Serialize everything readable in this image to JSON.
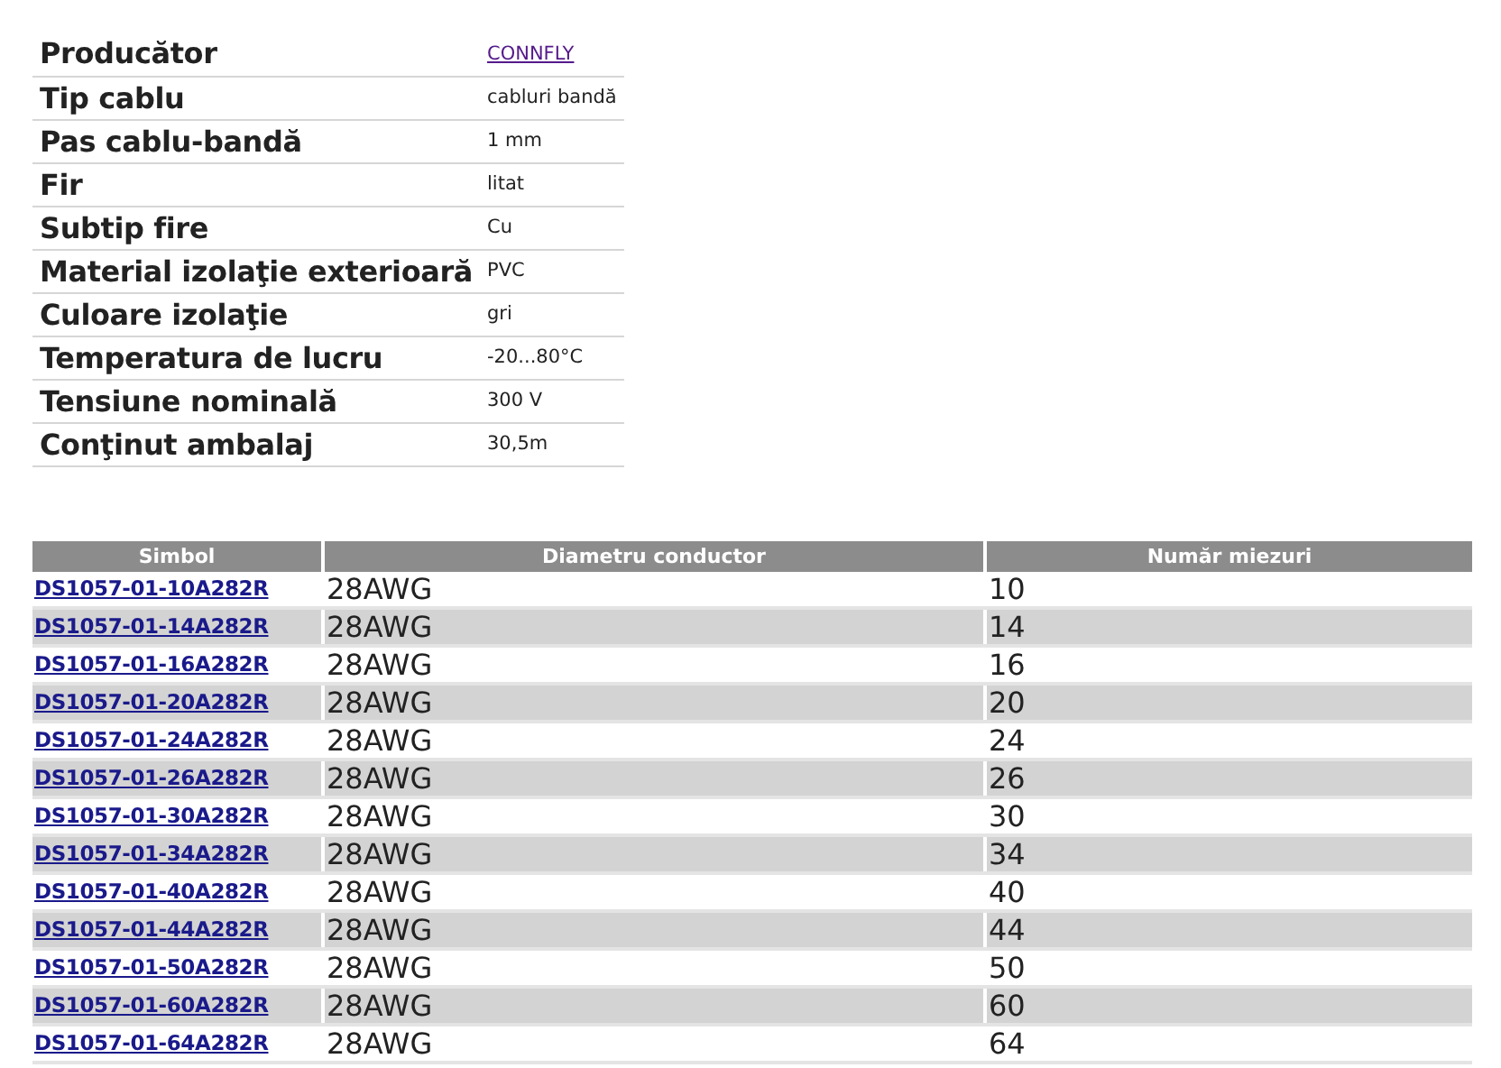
{
  "specs": [
    {
      "label": "Producător",
      "value": "CONNFLY",
      "kind": "link"
    },
    {
      "label": "Tip cablu",
      "value": "cabluri bandă",
      "kind": "text"
    },
    {
      "label": "Pas cablu-bandă",
      "value": "1 mm",
      "kind": "text"
    },
    {
      "label": "Fir",
      "value": "litat",
      "kind": "text"
    },
    {
      "label": "Subtip fire",
      "value": "Cu",
      "kind": "text"
    },
    {
      "label": "Material izolaţie exterioară",
      "value": "PVC",
      "kind": "text"
    },
    {
      "label": "Culoare izolaţie",
      "value": "gri",
      "kind": "text"
    },
    {
      "label": "Temperatura de lucru",
      "value": "-20...80°C",
      "kind": "text"
    },
    {
      "label": "Tensiune nominală",
      "value": "300 V",
      "kind": "text"
    },
    {
      "label": "Conţinut ambalaj",
      "value": "30,5m",
      "kind": "text"
    }
  ],
  "products": {
    "columns": [
      "Simbol",
      "Diametru conductor",
      "Număr miezuri"
    ],
    "rows": [
      [
        "DS1057-01-10A282R",
        "28AWG",
        "10"
      ],
      [
        "DS1057-01-14A282R",
        "28AWG",
        "14"
      ],
      [
        "DS1057-01-16A282R",
        "28AWG",
        "16"
      ],
      [
        "DS1057-01-20A282R",
        "28AWG",
        "20"
      ],
      [
        "DS1057-01-24A282R",
        "28AWG",
        "24"
      ],
      [
        "DS1057-01-26A282R",
        "28AWG",
        "26"
      ],
      [
        "DS1057-01-30A282R",
        "28AWG",
        "30"
      ],
      [
        "DS1057-01-34A282R",
        "28AWG",
        "34"
      ],
      [
        "DS1057-01-40A282R",
        "28AWG",
        "40"
      ],
      [
        "DS1057-01-44A282R",
        "28AWG",
        "44"
      ],
      [
        "DS1057-01-50A282R",
        "28AWG",
        "50"
      ],
      [
        "DS1057-01-60A282R",
        "28AWG",
        "60"
      ],
      [
        "DS1057-01-64A282R",
        "28AWG",
        "64"
      ]
    ]
  }
}
